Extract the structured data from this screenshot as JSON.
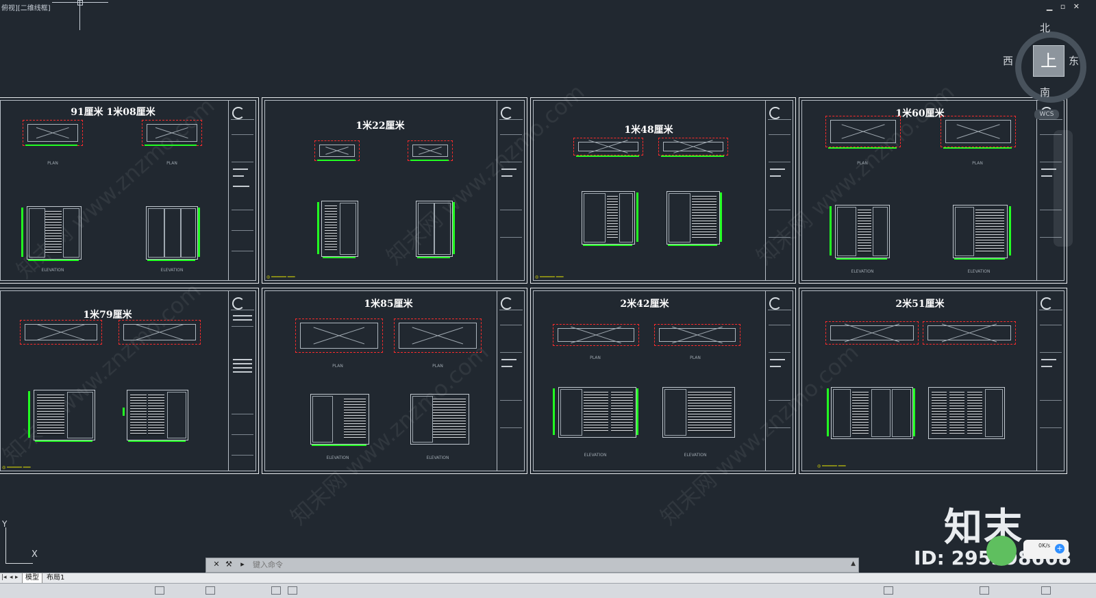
{
  "viewport": {
    "label": "俯视][二维线框]"
  },
  "window": {
    "controls": "▁ ▫ ✕"
  },
  "viewcube": {
    "top_face": "上",
    "north": "北",
    "south": "南",
    "east": "东",
    "west": "西",
    "wcs": "WCS"
  },
  "sheets": [
    {
      "title": "91厘米 1米08厘米",
      "captions": [
        "PLAN",
        "ELEVATION"
      ]
    },
    {
      "title": "1米22厘米"
    },
    {
      "title": "1米48厘米"
    },
    {
      "title": "1米60厘米",
      "captions": [
        "PLAN",
        "ELEVATION"
      ]
    },
    {
      "title": "1米79厘米"
    },
    {
      "title": "1米85厘米",
      "captions": [
        "PLAN",
        "ELEVATION"
      ]
    },
    {
      "title": "2米42厘米",
      "captions": [
        "PLAN",
        "ELEVATION"
      ]
    },
    {
      "title": "2米51厘米"
    }
  ],
  "watermark": {
    "text": "知末网 www.znzmo.com"
  },
  "brand": {
    "name": "知末",
    "id": "ID: 295398668"
  },
  "network": {
    "speed": "0K/s"
  },
  "ucs": {
    "x": "X",
    "y": "Y"
  },
  "command": {
    "placeholder": "键入命令"
  },
  "layout_tabs": {
    "model": "模型",
    "layout1": "布局1"
  }
}
